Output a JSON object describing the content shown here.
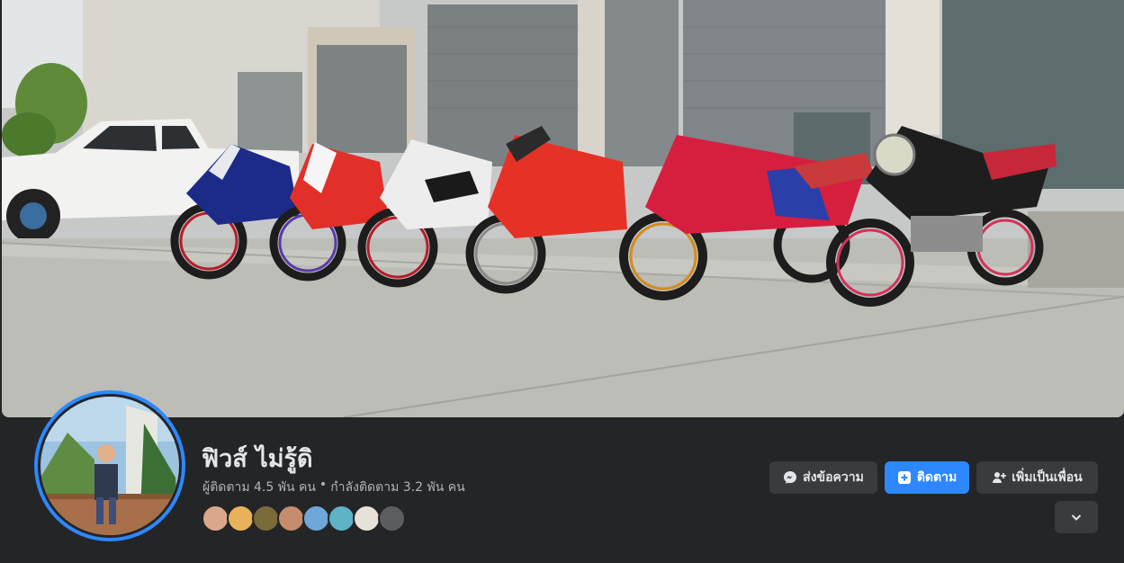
{
  "profile": {
    "name": "ฟิวส์ ไม่รู้ดิ",
    "followers_text": "ผู้ติดตาม 4.5 พัน คน",
    "separator": "•",
    "following_text": "กำลังติดตาม 3.2 พัน คน"
  },
  "actions": {
    "message_label": "ส่งข้อความ",
    "follow_label": "ติดตาม",
    "add_friend_label": "เพิ่มเป็นเพื่อน"
  },
  "icons": [
    "messenger-icon",
    "follow-plus-icon",
    "add-friend-icon",
    "chevron-down-icon"
  ],
  "colors": {
    "accent": "#2d88ff",
    "background": "#242526",
    "button": "#3a3b3c",
    "text_primary": "#e4e6eb",
    "text_secondary": "#b0b3b8"
  }
}
